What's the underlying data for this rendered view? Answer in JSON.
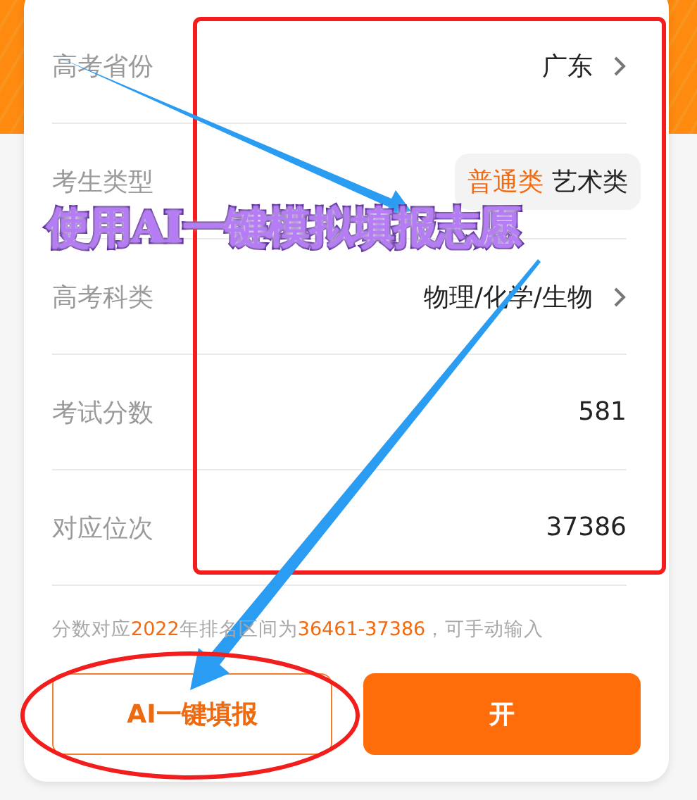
{
  "rows": [
    {
      "kind": "select",
      "label": "高考省份",
      "value": "广东"
    },
    {
      "kind": "segment",
      "label": "考生类型",
      "options": [
        {
          "label": "普通类",
          "selected": true
        },
        {
          "label": "艺术类",
          "selected": false
        }
      ]
    },
    {
      "kind": "select",
      "label": "高考科类",
      "value": "物理/化学/生物"
    },
    {
      "kind": "value",
      "label": "考试分数",
      "value": "581"
    },
    {
      "kind": "value",
      "label": "对应位次",
      "value": "37386"
    }
  ],
  "hint": [
    {
      "text": "分数对应",
      "highlight": false
    },
    {
      "text": "2022",
      "highlight": true
    },
    {
      "text": "年排名区间为",
      "highlight": false
    },
    {
      "text": "36461-37386",
      "highlight": true
    },
    {
      "text": "，可手动输入",
      "highlight": false
    }
  ],
  "buttons": [
    {
      "kind": "outline",
      "label": "AI一键填报"
    },
    {
      "kind": "filled",
      "label": "开"
    }
  ],
  "annotation": {
    "caption": "使用AI一键模拟填报志愿"
  }
}
